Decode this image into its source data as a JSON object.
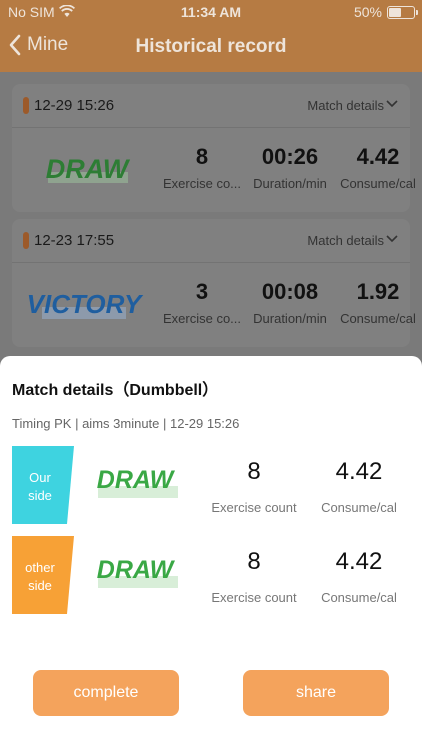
{
  "status_bar": {
    "carrier": "No SIM",
    "time": "11:34 AM",
    "battery": "50%",
    "battery_level": 0.5
  },
  "nav": {
    "back_label": "Mine",
    "title": "Historical record"
  },
  "records": [
    {
      "date": "12-29 15:26",
      "details_label": "Match details",
      "result": "DRAW",
      "stats": [
        {
          "value": "8",
          "label": "Exercise co..."
        },
        {
          "value": "00:26",
          "label": "Duration/min"
        },
        {
          "value": "4.42",
          "label": "Consume/cal"
        }
      ]
    },
    {
      "date": "12-23 17:55",
      "details_label": "Match details",
      "result": "VICTORY",
      "stats": [
        {
          "value": "3",
          "label": "Exercise co..."
        },
        {
          "value": "00:08",
          "label": "Duration/min"
        },
        {
          "value": "1.92",
          "label": "Consume/cal"
        }
      ]
    }
  ],
  "sheet": {
    "title": "Match details（Dumbbell）",
    "meta": "Timing PK | aims 3minute | 12-29 15:26",
    "sides": [
      {
        "tag_line1": "Our",
        "tag_line2": "side",
        "color": "#3ed3e0",
        "result": "DRAW",
        "count_value": "8",
        "count_label": "Exercise count",
        "cal_value": "4.42",
        "cal_label": "Consume/cal"
      },
      {
        "tag_line1": "other",
        "tag_line2": "side",
        "color": "#f7a136",
        "result": "DRAW",
        "count_value": "8",
        "count_label": "Exercise count",
        "cal_value": "4.42",
        "cal_label": "Consume/cal"
      }
    ],
    "complete_label": "complete",
    "share_label": "share"
  },
  "colors": {
    "accent": "#f4a35c",
    "draw_green": "#3aa845",
    "victory_blue": "#2b7fd0"
  }
}
